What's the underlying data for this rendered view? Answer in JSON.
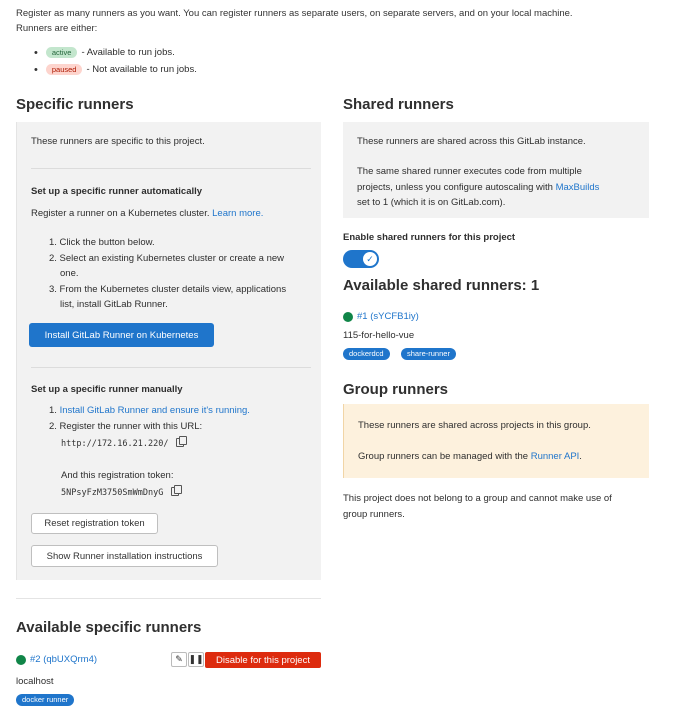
{
  "intro": {
    "line1": "Register as many runners as you want. You can register runners as separate users, on separate servers, and on your local machine.",
    "line2": "Runners are either:",
    "statuses": [
      {
        "badge": "active",
        "text": " - Available to run jobs."
      },
      {
        "badge": "paused",
        "text": " - Not available to run jobs."
      }
    ]
  },
  "specific": {
    "title": "Specific runners",
    "desc": "These runners are specific to this project.",
    "auto_heading": "Set up a specific runner automatically",
    "auto_text": "Register a runner on a Kubernetes cluster. ",
    "learn_more": "Learn more.",
    "steps": [
      "1. Click the button below.",
      "2. Select an existing Kubernetes cluster or create a new",
      "one.",
      "3. From the Kubernetes cluster details view, applications",
      "list, install GitLab Runner."
    ],
    "install_button": "Install GitLab Runner on Kubernetes",
    "manual_heading": "Set up a specific runner manually",
    "manual_step1_prefix": "1. ",
    "manual_step1_link": "Install GitLab Runner and ensure it's running.",
    "manual_step2": "2. Register the runner with this URL:",
    "url": "http://172.16.21.220/",
    "token_label": "And this registration token:",
    "token": "5NPsyFzM3750SmWmDnyG",
    "reset_button": "Reset registration token",
    "instructions_button": "Show Runner installation instructions"
  },
  "shared": {
    "title": "Shared runners",
    "desc1": "These runners are shared across this GitLab instance.",
    "desc2a": "The same shared runner executes code from multiple",
    "desc2b": "projects, unless you configure autoscaling with ",
    "desc2_link": "MaxBuilds",
    "desc2c": "set to 1 (which it is on GitLab.com).",
    "toggle_label": "Enable shared runners for this project",
    "available_title": "Available shared runners: 1",
    "runner_id": "#1 (sYCFB1iy)",
    "runner_desc": "115-for-hello-vue",
    "tags": [
      "dockerdcd",
      "share-runner"
    ]
  },
  "group": {
    "title": "Group runners",
    "desc1": "These runners are shared across projects in this group.",
    "desc2_prefix": "Group runners can be managed with the ",
    "desc2_link": "Runner API",
    "desc2_suffix": ".",
    "note1": "This project does not belong to a group and cannot make use of",
    "note2": "group runners."
  },
  "available_specific": {
    "title": "Available specific runners",
    "runner_id": "#2 (qbUXQrm4)",
    "runner_desc": "localhost",
    "tag": "docker runner",
    "disable_button": "Disable for this project"
  },
  "colors": {
    "accent": "#1f75cb",
    "danger": "#dd2b0e",
    "online": "#108548"
  }
}
